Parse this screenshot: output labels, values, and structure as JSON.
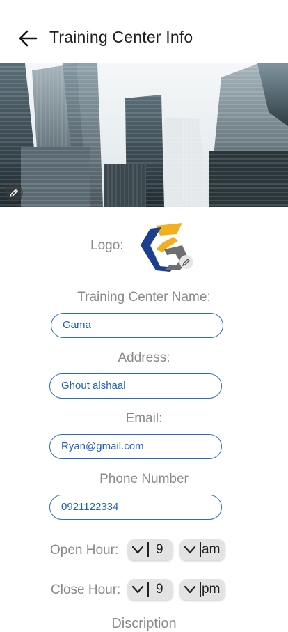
{
  "header": {
    "title": "Training Center Info"
  },
  "form": {
    "logo_label": "Logo:",
    "name_label": "Training Center Name:",
    "name_value": "Gama",
    "address_label": "Address:",
    "address_value": "Ghout alshaal",
    "email_label": "Email:",
    "email_value": "Ryan@gmail.com",
    "phone_label": "Phone Number",
    "phone_value": "0921122334",
    "open_label": "Open Hour:",
    "open_hour": "9",
    "open_period": "am",
    "close_label": "Close Hour:",
    "close_hour": "9",
    "close_period": "pm",
    "next_heading_partial": "Discription"
  },
  "colors": {
    "accent": "#1f5fc4",
    "logo_blue": "#1d3f8f",
    "logo_yellow": "#f2b01e",
    "logo_gray": "#6f6f6f"
  },
  "icons": {
    "back": "arrow-left-icon",
    "edit": "pencil-icon"
  }
}
